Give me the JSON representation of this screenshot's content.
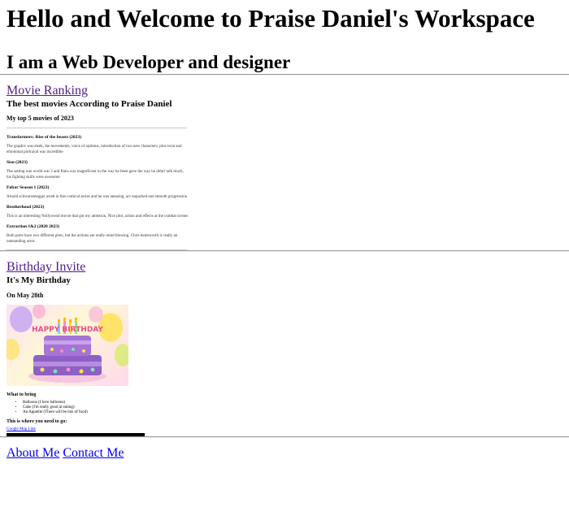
{
  "header": {
    "title": "Hello and Welcome to Praise Daniel's Workspace",
    "subtitle": "I am a Web Developer and designer"
  },
  "movies_section": {
    "link_label": "Movie Ranking",
    "heading": "The best movies According to Praise Daniel",
    "subheading": "My top 5 movies of 2023",
    "items": [
      {
        "title": "Transformers: Rise of the beasts (2023)",
        "description": "The graphic was sleek, the movements, voice of optimus, introduction of two new characters, plot twist and emotional portrayal was incredible"
      },
      {
        "title": "Sisu (2023)",
        "description": "The setting was world war 2 and finns was magnificent in the way he been gave the way he didn't talk much, his fighting skills were awesome"
      },
      {
        "title": "Fubar Season 1 (2023)",
        "description": "Arnold schwarzenegger acted in this comical series and he was amazing, act unpacked and smooth progression"
      },
      {
        "title": "Brotherhood (2023)",
        "description": "This is an interesting Nollywood movie that got my attention, Nice plot, action and effects at the combat scenes"
      },
      {
        "title": "Extraction 1&2 (2020 2023)",
        "description": "Both parts have two different plots, but the actions are really mind blowing. Chris hemsworth is really an outstanding actor."
      }
    ]
  },
  "birthday_section": {
    "link_label": "Birthday Invite",
    "heading": "It's My Birthday",
    "date": "On May 28th",
    "image_text": "HAPPY BIRTHDAY",
    "bring_title": "What to bring",
    "bring_items": [
      "Balloons (I love balloons)",
      "Cake (I'm really good at eating)",
      "An Appetite (There will be lots of food)"
    ],
    "where_text": "This is where you need to go:",
    "map_link": "Google Map Link"
  },
  "footer": {
    "about_label": "About Me",
    "contact_label": "Contact Me"
  },
  "colors": {
    "visited_link": "#551a8b",
    "link": "#0000ee",
    "rule": "#9a9a9a"
  }
}
